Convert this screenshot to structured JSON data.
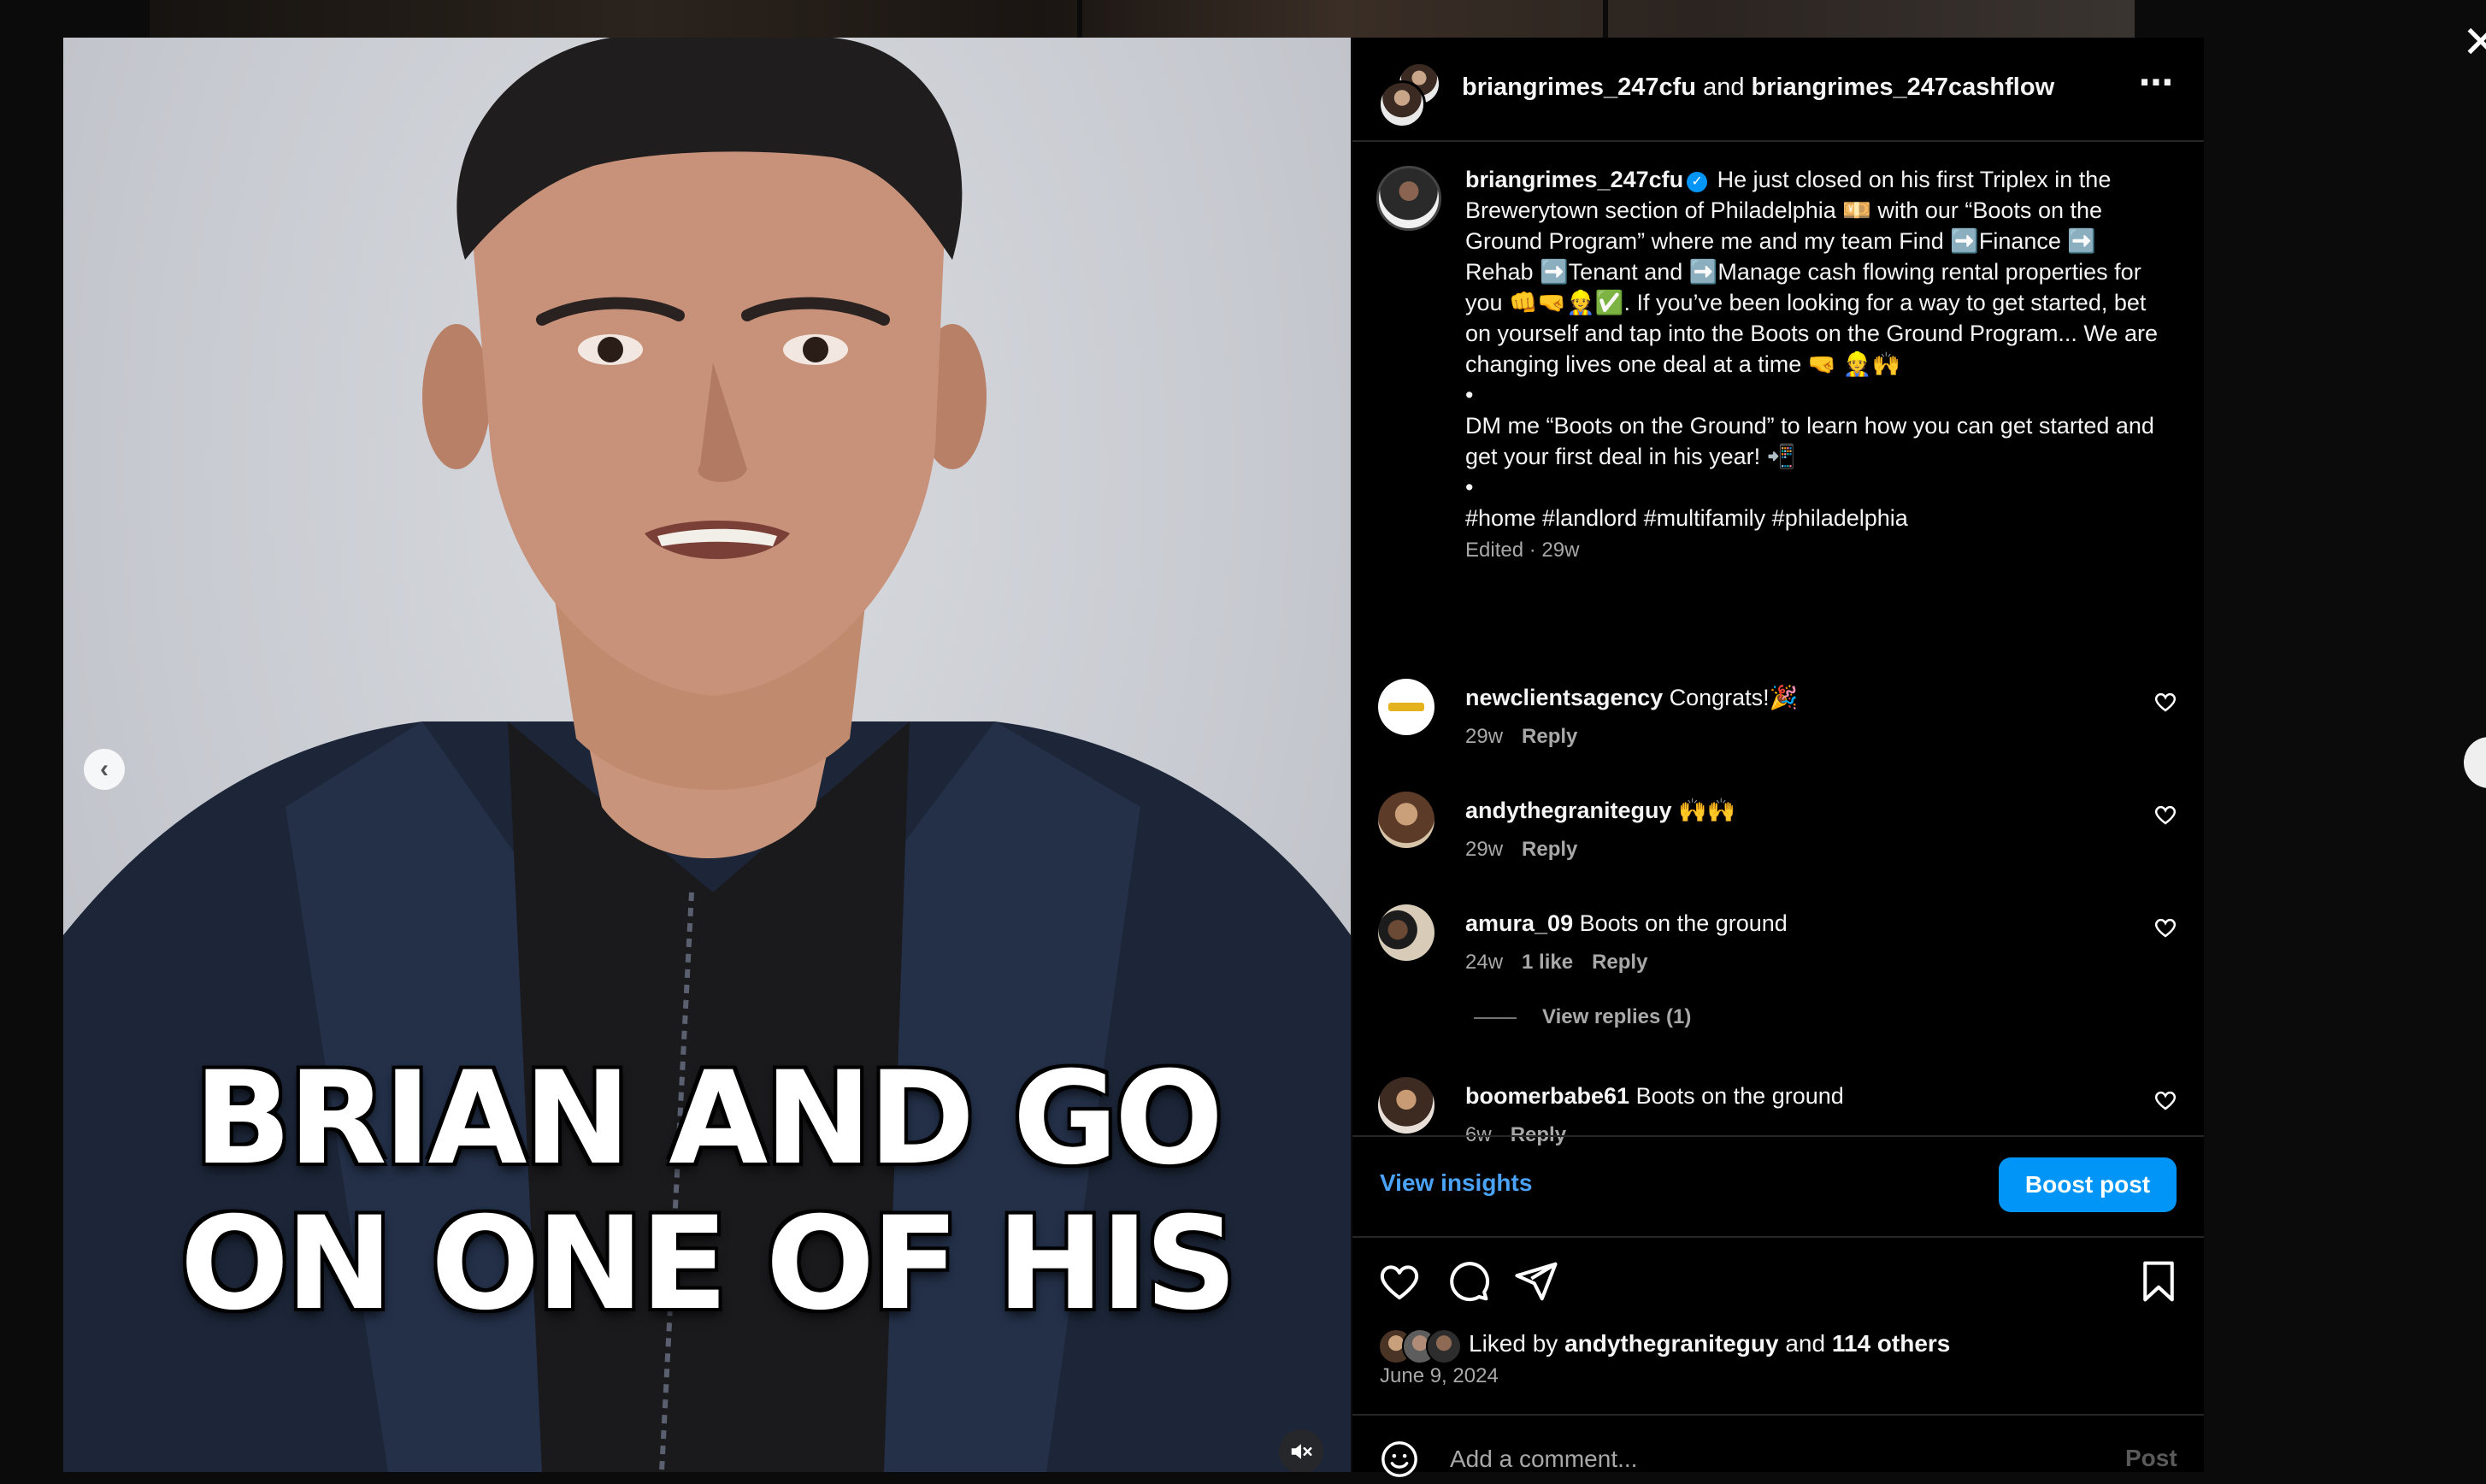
{
  "post": {
    "header_user1": "briangrimes_247cfu",
    "header_and": "and",
    "header_user2": "briangrimes_247cashflow",
    "more_icon": "⋯"
  },
  "video": {
    "overlay_line1": "BRIAN AND GO",
    "overlay_line2": "ON ONE OF HIS",
    "prev_icon": "‹"
  },
  "caption": {
    "username": "briangrimes_247cfu",
    "verified_icon": "✓",
    "p1": "He just closed on his first Triplex in the Brewerytown section of Philadelphia 💴 with our “Boots on the Ground Program” where me and my team Find ➡️Finance ➡️ Rehab ➡️Tenant and ➡️Manage cash flowing rental properties for you 👊🤜👷✅. If you’ve been looking for a way to get started, bet on yourself and tap into the Boots on the Ground Program... We are changing lives one deal at a time 🤜 👷🙌",
    "bullet1": "•",
    "p2": "DM me “Boots on the Ground” to learn how you can get started and get your first deal in his year! 📲",
    "bullet2": "•",
    "hashtags": "#home #landlord #multifamily #philadelphia",
    "meta": "Edited · 29w"
  },
  "comments": [
    {
      "user": "newclientsagency",
      "text": "Congrats!🎉",
      "time": "29w",
      "likes": "",
      "reply": "Reply"
    },
    {
      "user": "andythegraniteguy",
      "text": "🙌🙌",
      "time": "29w",
      "likes": "",
      "reply": "Reply"
    },
    {
      "user": "amura_09",
      "text": "Boots on the ground",
      "time": "24w",
      "likes": "1 like",
      "reply": "Reply",
      "view_replies": "View replies (1)"
    },
    {
      "user": "boomerbabe61",
      "text": "Boots on the ground",
      "time": "6w",
      "likes": "",
      "reply": "Reply"
    }
  ],
  "insights": {
    "view_insights": "View insights",
    "boost": "Boost post"
  },
  "likes": {
    "prefix": "Liked by",
    "user": "andythegraniteguy",
    "and": "and",
    "others": "114 others",
    "date": "June 9, 2024"
  },
  "composer": {
    "placeholder": "Add a comment...",
    "post": "Post"
  },
  "icons": {
    "close": "✕",
    "like": "heart-icon",
    "comment": "comment-icon",
    "share": "share-icon",
    "save": "bookmark-icon",
    "mute": "muted-speaker-icon",
    "emoji": "smiley-icon"
  },
  "colors": {
    "accent_blue": "#0095f6",
    "link_blue": "#4aa3f8",
    "bg": "#000000",
    "muted_text": "#a8a8a8"
  }
}
